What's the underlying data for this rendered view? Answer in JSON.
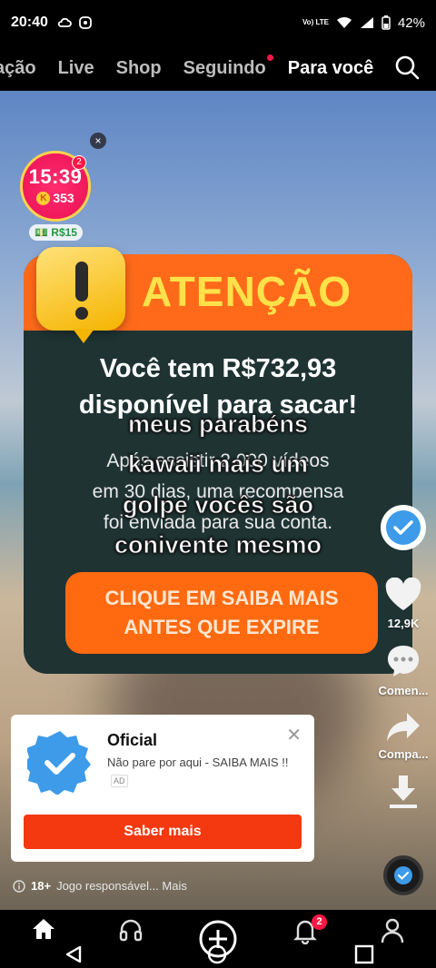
{
  "status_bar": {
    "time": "20:40",
    "network": "Vo) LTE",
    "battery": "42%"
  },
  "top_nav": {
    "tabs": [
      "ação",
      "Live",
      "Shop",
      "Seguindo",
      "Para você"
    ],
    "active": "Para você"
  },
  "timer_widget": {
    "time": "15:39",
    "coins": "353",
    "badge": "2",
    "reward": "R$15",
    "coin_letter": "K"
  },
  "alert": {
    "header": "ATENÇÃO",
    "line1": "Você tem R$732,93",
    "line2": "disponível para sacar!",
    "body1": "Após assistir 2.000 vídeos",
    "body2": "em 30 dias, uma recompensa",
    "body3": "foi enviada para sua conta.",
    "cta1": "CLIQUE EM SAIBA MAIS",
    "cta2": "ANTES QUE EXPIRE"
  },
  "caption": [
    "meus parabéns",
    "kawaii mais um",
    "golpe vocês são",
    "conivente mesmo"
  ],
  "action_rail": {
    "likes": "12,9K",
    "comments": "Comen...",
    "share": "Compa..."
  },
  "ad_card": {
    "title": "Oficial",
    "subtitle": "Não pare por aqui - SAIBA MAIS !!",
    "ad_label": "AD",
    "button": "Saber mais"
  },
  "footer_note": {
    "age": "18+",
    "text": "Jogo responsável... Mais"
  },
  "bottom_nav": {
    "inbox_badge": "2"
  },
  "colors": {
    "accent_orange": "#ff6a1a",
    "alert_yellow": "#ffe14a",
    "cta_red": "#f4380f",
    "verified_blue": "#3d9be9"
  }
}
